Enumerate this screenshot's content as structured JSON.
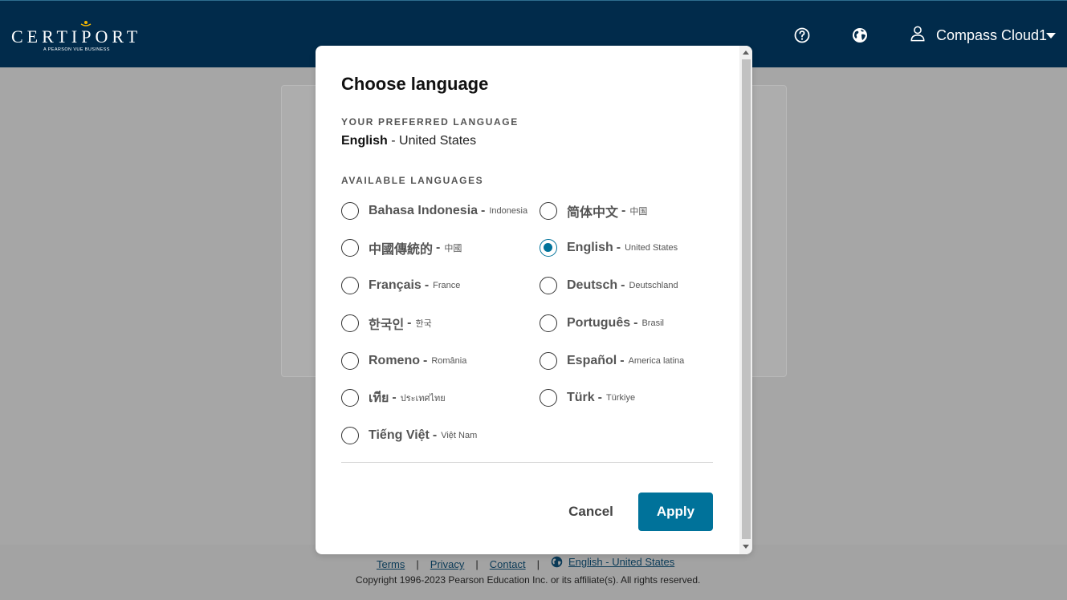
{
  "header": {
    "logo_text": "CERTIPORT",
    "logo_tagline": "A PEARSON VUE BUSINESS",
    "help_icon": "help-circle-icon",
    "globe_icon": "globe-icon",
    "user_icon": "user-icon",
    "user_name": "Compass Cloud1"
  },
  "modal": {
    "title": "Choose language",
    "preferred_label": "YOUR PREFERRED LANGUAGE",
    "preferred_language": "English",
    "preferred_region": "- United States",
    "available_label": "AVAILABLE LANGUAGES",
    "languages": [
      {
        "name": "Bahasa Indonesia",
        "region": "Indonesia",
        "checked": false
      },
      {
        "name": "简体中文",
        "region": "中国",
        "checked": false
      },
      {
        "name": "中國傳統的",
        "region": "中國",
        "checked": false
      },
      {
        "name": "English",
        "region": "United States",
        "checked": true
      },
      {
        "name": "Français",
        "region": "France",
        "checked": false
      },
      {
        "name": "Deutsch",
        "region": "Deutschland",
        "checked": false
      },
      {
        "name": "한국인",
        "region": "한국",
        "checked": false
      },
      {
        "name": "Português",
        "region": "Brasil",
        "checked": false
      },
      {
        "name": "Romeno",
        "region": "România",
        "checked": false
      },
      {
        "name": "Español",
        "region": "America latina",
        "checked": false
      },
      {
        "name": "เทีย",
        "region": "ประเทศไทย",
        "checked": false
      },
      {
        "name": "Türk",
        "region": "Türkiye",
        "checked": false
      },
      {
        "name": "Tiếng Việt",
        "region": "Việt Nam",
        "checked": false
      }
    ],
    "dash": "-",
    "cancel_label": "Cancel",
    "apply_label": "Apply"
  },
  "footer": {
    "terms": "Terms",
    "privacy": "Privacy",
    "contact": "Contact",
    "separator": "|",
    "language_link": "English - United States",
    "copyright": "Copyright 1996-2023 Pearson Education Inc. or its affiliate(s). All rights reserved."
  },
  "colors": {
    "header_bg": "#012b4b",
    "accent": "#00729a",
    "overlay_bg": "#a6a6a6"
  }
}
